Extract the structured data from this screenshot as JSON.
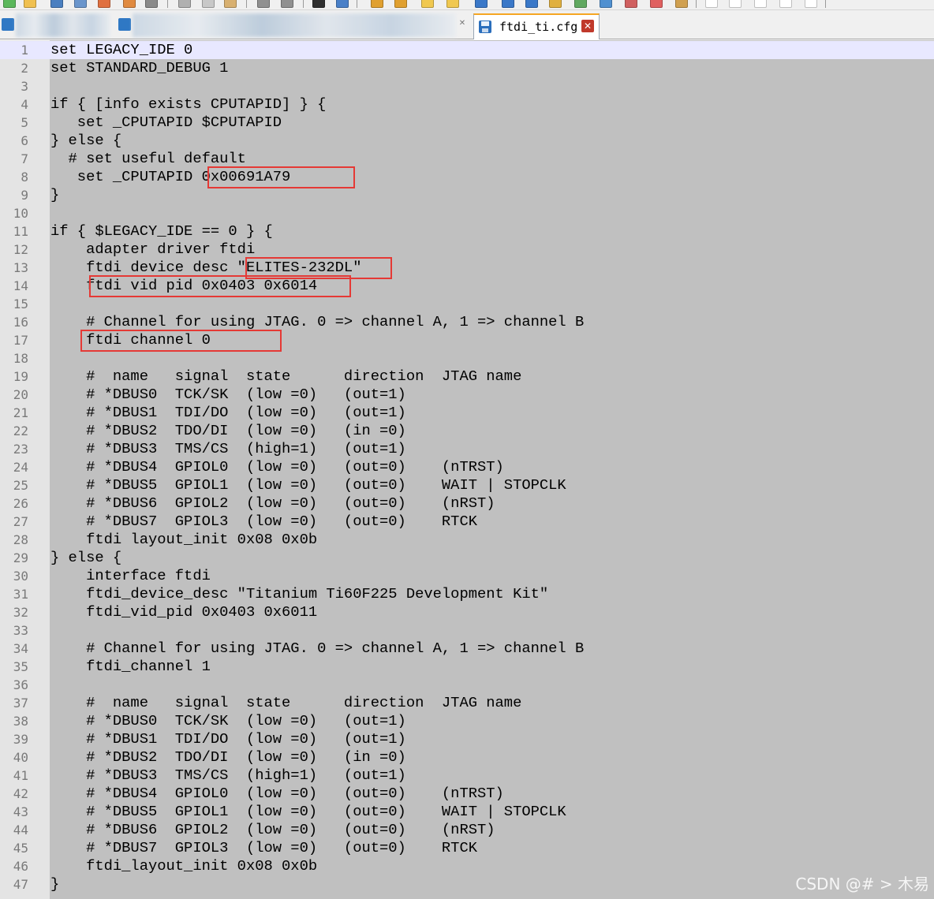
{
  "tabs": {
    "active_title": "ftdi_ti.cfg"
  },
  "colors": {
    "editor_background": "#c0c0c0",
    "gutter_background": "#e4e4e4",
    "current_line": "#e8e8ff",
    "highlight_box": "#e53935"
  },
  "editor": {
    "current_line_index": 0,
    "lines": [
      "set LEGACY_IDE 0",
      "set STANDARD_DEBUG 1",
      "",
      "if { [info exists CPUTAPID] } {",
      "   set _CPUTAPID $CPUTAPID",
      "} else {",
      "  # set useful default",
      "   set _CPUTAPID 0x00691A79",
      "}",
      "",
      "if { $LEGACY_IDE == 0 } {",
      "    adapter driver ftdi",
      "    ftdi device desc \"ELITES-232DL\"",
      "    ftdi vid pid 0x0403 0x6014",
      "",
      "    # Channel for using JTAG. 0 => channel A, 1 => channel B",
      "    ftdi channel 0",
      "",
      "    #  name   signal  state      direction  JTAG name",
      "    # *DBUS0  TCK/SK  (low =0)   (out=1)",
      "    # *DBUS1  TDI/DO  (low =0)   (out=1)",
      "    # *DBUS2  TDO/DI  (low =0)   (in =0)",
      "    # *DBUS3  TMS/CS  (high=1)   (out=1)",
      "    # *DBUS4  GPIOL0  (low =0)   (out=0)    (nTRST)",
      "    # *DBUS5  GPIOL1  (low =0)   (out=0)    WAIT | STOPCLK",
      "    # *DBUS6  GPIOL2  (low =0)   (out=0)    (nRST)",
      "    # *DBUS7  GPIOL3  (low =0)   (out=0)    RTCK",
      "    ftdi layout_init 0x08 0x0b",
      "} else {",
      "    interface ftdi",
      "    ftdi_device_desc \"Titanium Ti60F225 Development Kit\"",
      "    ftdi_vid_pid 0x0403 0x6011",
      "",
      "    # Channel for using JTAG. 0 => channel A, 1 => channel B",
      "    ftdi_channel 1",
      "",
      "    #  name   signal  state      direction  JTAG name",
      "    # *DBUS0  TCK/SK  (low =0)   (out=1)",
      "    # *DBUS1  TDI/DO  (low =0)   (out=1)",
      "    # *DBUS2  TDO/DI  (low =0)   (in =0)",
      "    # *DBUS3  TMS/CS  (high=1)   (out=1)",
      "    # *DBUS4  GPIOL0  (low =0)   (out=0)    (nTRST)",
      "    # *DBUS5  GPIOL1  (low =0)   (out=0)    WAIT | STOPCLK",
      "    # *DBUS6  GPIOL2  (low =0)   (out=0)    (nRST)",
      "    # *DBUS7  GPIOL3  (low =0)   (out=0)    RTCK",
      "    ftdi_layout_init 0x08 0x0b",
      "}"
    ]
  },
  "highlighted_line_numbers": [
    8,
    13,
    14,
    17
  ],
  "watermark": "CSDN @# > 木易"
}
